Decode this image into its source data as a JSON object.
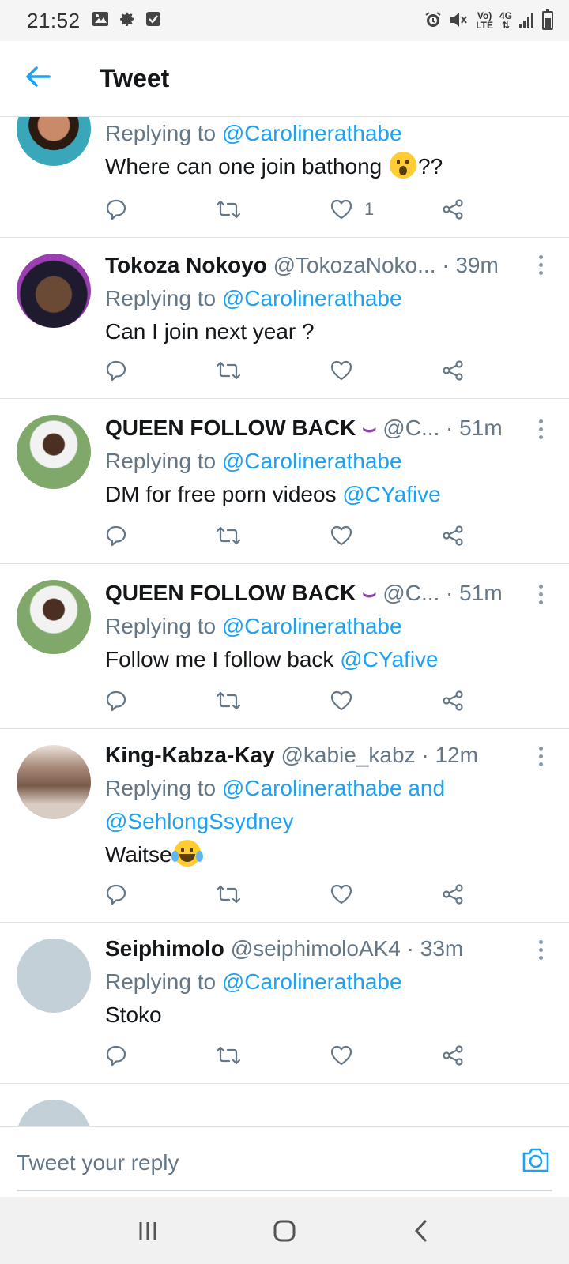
{
  "status_bar": {
    "time": "21:52",
    "left_icons": [
      "image-icon",
      "gear-icon",
      "check-box-icon"
    ],
    "right_icons": [
      "alarm-icon",
      "mute-icon",
      "volte-icon",
      "network-4g-icon",
      "signal-icon",
      "battery-icon"
    ],
    "volte_label_top": "Vo)",
    "volte_label_bottom": "LTE",
    "network_label": "4G"
  },
  "header": {
    "title": "Tweet"
  },
  "tweets": [
    {
      "replying_prefix": "Replying to ",
      "replying_to": "@Carolinerathabe",
      "text": "Where can one join bathong ",
      "text_after_emoji": "??",
      "emoji": "hushed-face-emoji",
      "like_count": "1"
    },
    {
      "name": "Tokoza Nokoyo",
      "handle": "@TokozaNoko...",
      "time": "39m",
      "replying_prefix": "Replying to ",
      "replying_to": "@Carolinerathabe",
      "text": "Can I join next year ?"
    },
    {
      "name": "QUEEN FOLLOW BACK",
      "name_emoji": "purple-bikini-emoji",
      "handle": "@C...",
      "time": "51m",
      "replying_prefix": "Replying to ",
      "replying_to": "@Carolinerathabe",
      "text": "DM for free porn videos ",
      "text_mention": "@CYafive"
    },
    {
      "name": "QUEEN FOLLOW BACK",
      "name_emoji": "purple-bikini-emoji",
      "handle": "@C...",
      "time": "51m",
      "replying_prefix": "Replying to ",
      "replying_to": "@Carolinerathabe",
      "text": "Follow me I follow back ",
      "text_mention": "@CYafive"
    },
    {
      "name": "King-Kabza-Kay",
      "handle": "@kabie_kabz",
      "time": "12m",
      "replying_prefix": "Replying to ",
      "replying_to": "@Carolinerathabe",
      "replying_and": " and",
      "replying_to_2": "@SehlongSsydney",
      "text": "Waitse",
      "emoji": "tears-of-joy-emoji"
    },
    {
      "name": "Seiphimolo",
      "handle": "@seiphimoloAK4",
      "time": "33m",
      "replying_prefix": "Replying to ",
      "replying_to": "@Carolinerathabe",
      "text": "Stoko"
    }
  ],
  "composer": {
    "placeholder": "Tweet your reply"
  },
  "colors": {
    "accent": "#1da1f2",
    "secondary_text": "#657786",
    "divider": "#dfe3e6"
  }
}
